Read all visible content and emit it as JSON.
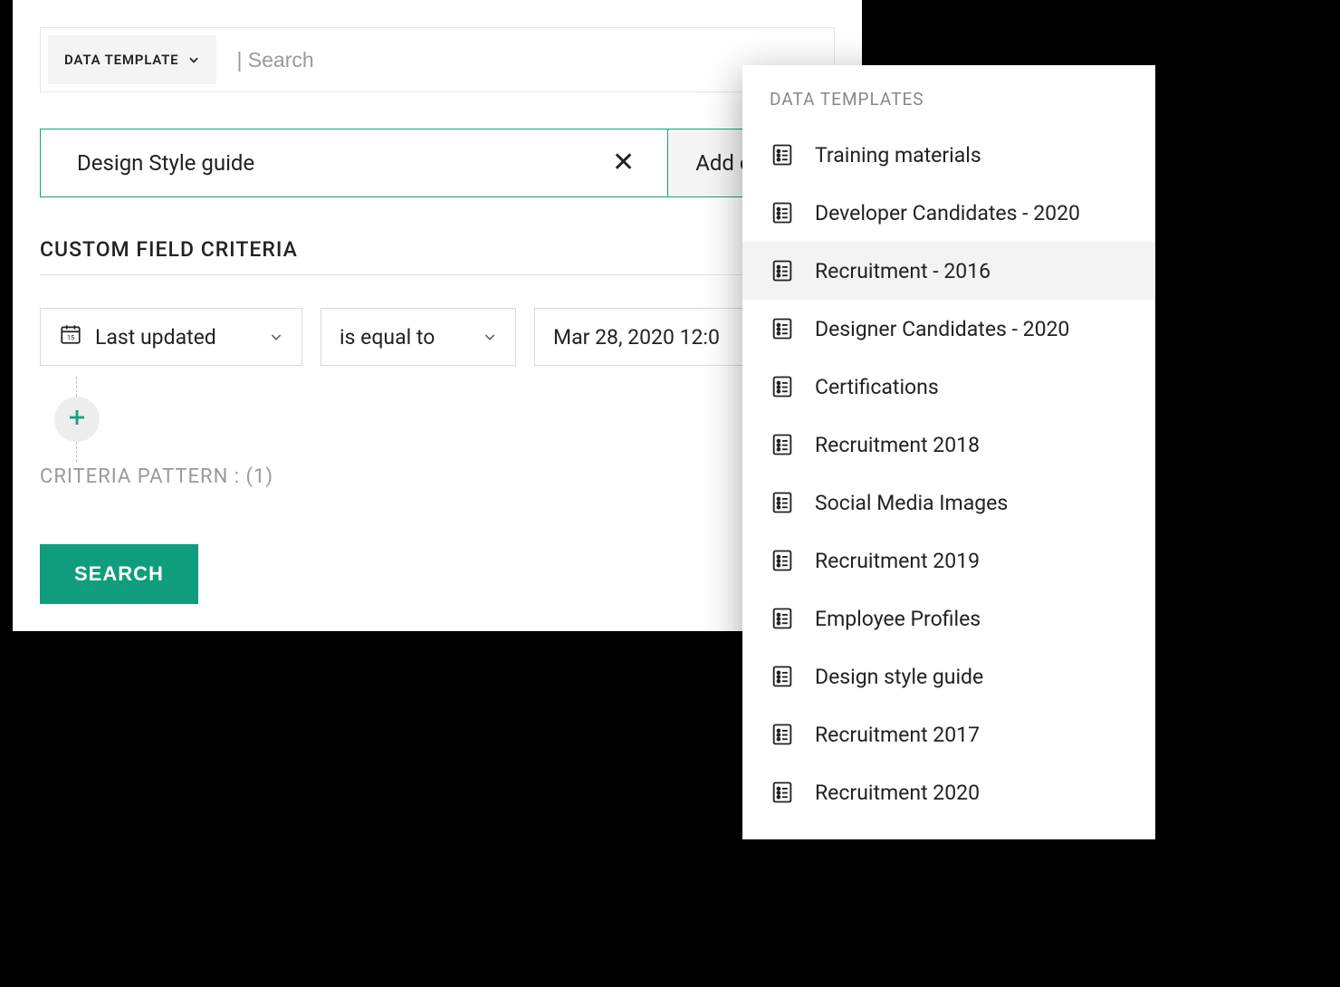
{
  "colors": {
    "accent": "#10a37f",
    "button": "#0F9D7D"
  },
  "header": {
    "trigger_label": "DATA TEMPLATE",
    "search_placeholder": "| Search"
  },
  "criteria_bar": {
    "value": "Design Style guide",
    "add_label": "Add criteria"
  },
  "custom_field": {
    "section_title": "CUSTOM FIELD CRITERIA",
    "field_label": "Last updated",
    "operator_label": "is equal to",
    "value_label": "Mar 28, 2020 12:0"
  },
  "pattern": {
    "label": "CRITERIA PATTERN :",
    "value": "(1)"
  },
  "actions": {
    "search_label": "SEARCH"
  },
  "dropdown": {
    "header": "DATA TEMPLATES",
    "items": [
      {
        "label": "Training materials"
      },
      {
        "label": "Developer Candidates - 2020"
      },
      {
        "label": "Recruitment - 2016",
        "active": true
      },
      {
        "label": "Designer Candidates - 2020"
      },
      {
        "label": "Certifications"
      },
      {
        "label": "Recruitment 2018"
      },
      {
        "label": "Social Media Images"
      },
      {
        "label": "Recruitment 2019"
      },
      {
        "label": "Employee Profiles"
      },
      {
        "label": "Design style guide"
      },
      {
        "label": "Recruitment 2017"
      },
      {
        "label": "Recruitment 2020"
      }
    ]
  }
}
